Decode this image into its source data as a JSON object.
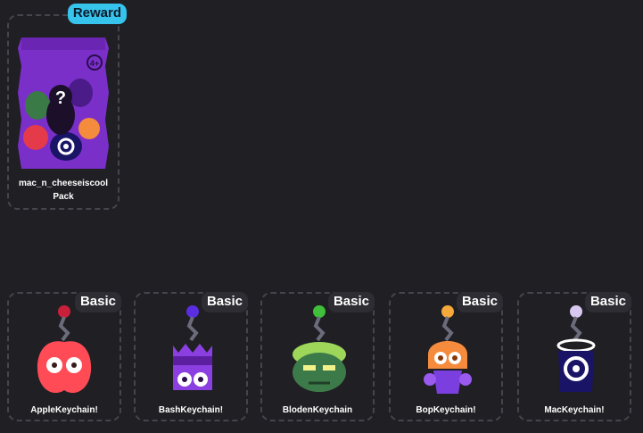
{
  "pack": {
    "badge": "Reward",
    "name": "mac_n_cheeseiscool",
    "subname": "Pack",
    "age_rating": "4+",
    "mystery_symbol": "?",
    "colors": {
      "bag": "#7b2fc9",
      "badge": "#36c3ec"
    }
  },
  "keychains": [
    {
      "badge": "Basic",
      "name": "AppleKeychain!",
      "icon": "apple-keychain-icon",
      "color": "#ff4b55"
    },
    {
      "badge": "Basic",
      "name": "BashKeychain!",
      "icon": "bash-keychain-icon",
      "color": "#8c3fe0"
    },
    {
      "badge": "Basic",
      "name": "BlodenKeychain",
      "icon": "bloden-keychain-icon",
      "color": "#3d7a4a"
    },
    {
      "badge": "Basic",
      "name": "BopKeychain!",
      "icon": "bop-keychain-icon",
      "color": "#f58b3c"
    },
    {
      "badge": "Basic",
      "name": "MacKeychain!",
      "icon": "mac-keychain-icon",
      "color": "#1a1466"
    }
  ]
}
